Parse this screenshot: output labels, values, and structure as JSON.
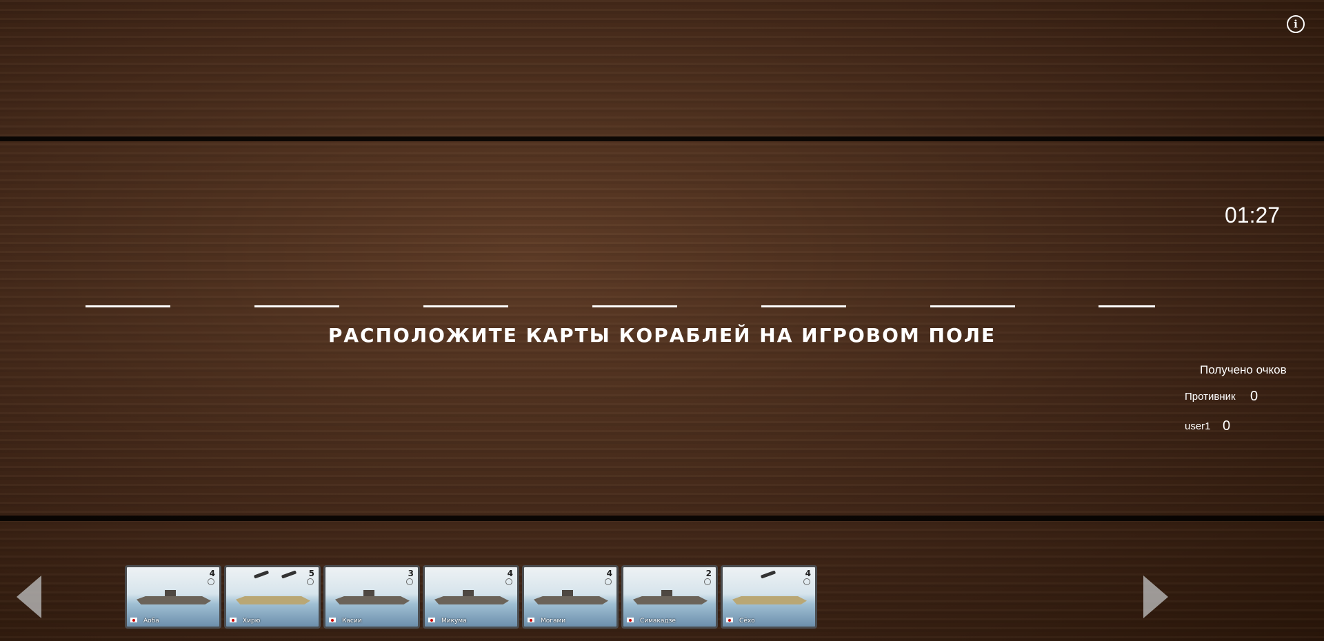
{
  "header": {
    "info_icon": "info-circle-icon"
  },
  "timer": "01:27",
  "board": {
    "instruction": "РАСПОЛОЖИТЕ КАРТЫ КОРАБЛЕЙ НА ИГРОВОМ ПОЛЕ",
    "slot_count": 7
  },
  "score": {
    "title": "Получено очков",
    "opponent_label": "Противник",
    "opponent_value": "0",
    "player_label": "user1",
    "player_value": "0"
  },
  "hand": {
    "prev_icon": "triangle-left-icon",
    "next_icon": "triangle-right-icon",
    "cards": [
      {
        "name": "Аоба",
        "cost": "4"
      },
      {
        "name": "Хирю",
        "cost": "5"
      },
      {
        "name": "Касии",
        "cost": "3"
      },
      {
        "name": "Микума",
        "cost": "4"
      },
      {
        "name": "Могами",
        "cost": "4"
      },
      {
        "name": "Симакадзе",
        "cost": "2"
      },
      {
        "name": "Сёхо",
        "cost": "4"
      }
    ]
  },
  "colors": {
    "text": "#ffffff",
    "wood_dark": "#281509",
    "wood_mid": "#5d3b26",
    "arrow": "#b9b9b9"
  }
}
